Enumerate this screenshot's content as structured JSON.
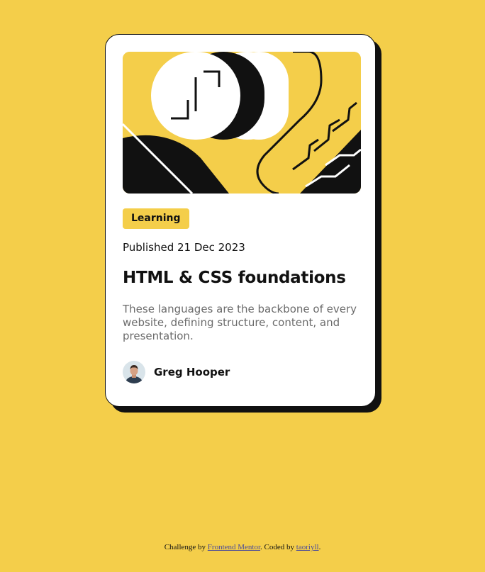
{
  "card": {
    "tag": "Learning",
    "published": "Published 21 Dec 2023",
    "title": "HTML & CSS foundations",
    "description": "These languages are the backbone of every website, defining structure, content, and presentation.",
    "author": {
      "name": "Greg Hooper",
      "avatar_icon": "user-avatar-photo"
    },
    "hero_icon": "code-illustration"
  },
  "footer": {
    "prefix": "Challenge by ",
    "link1": "Frontend Mentor",
    "middle": ". Coded by ",
    "link2": "taoriyll",
    "suffix": "."
  },
  "colors": {
    "background": "#F4CE4A",
    "card": "#FFFFFF",
    "ink": "#111111",
    "muted": "#6B6B6B"
  }
}
